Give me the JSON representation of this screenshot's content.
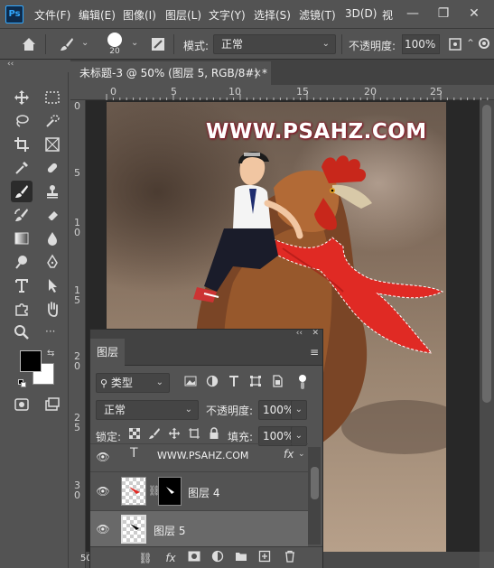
{
  "menubar": {
    "logo": "Ps",
    "items": [
      "文件(F)",
      "编辑(E)",
      "图像(I)",
      "图层(L)",
      "文字(Y)",
      "选择(S)",
      "滤镜(T)",
      "3D(D)",
      "视"
    ],
    "window_buttons": [
      "—",
      "❐",
      "✕"
    ]
  },
  "options": {
    "brush_size": "20",
    "mode_label": "模式:",
    "mode_value": "正常",
    "opacity_label": "不透明度:",
    "opacity_value": "100%"
  },
  "panel_collapse": "‹‹",
  "document": {
    "tab_title": "未标题-3 @ 50% (图层 5, RGB/8#) *",
    "close": "×"
  },
  "rulers": {
    "top": [
      "0",
      "5",
      "10",
      "15",
      "20",
      "25"
    ],
    "left": [
      "0",
      "5",
      "1\n0",
      "1\n5",
      "2\n0",
      "2\n5",
      "3\n0"
    ]
  },
  "canvas": {
    "watermark": "WWW.PSAHZ.COM",
    "status_partial": "50"
  },
  "layers_panel": {
    "collapse": "‹‹",
    "close": "✕",
    "tab": "图层",
    "filter_type": "类型",
    "blend_mode": "正常",
    "opacity_label": "不透明度:",
    "opacity_value": "100%",
    "lock_label": "锁定:",
    "fill_label": "填充:",
    "fill_value": "100%",
    "layers": [
      {
        "name": "WWW.PSAHZ.COM",
        "kind": "text",
        "fx": "fx"
      },
      {
        "name": "图层 4",
        "kind": "masked"
      },
      {
        "name": "图层 5",
        "kind": "pixel",
        "selected": true
      }
    ]
  }
}
